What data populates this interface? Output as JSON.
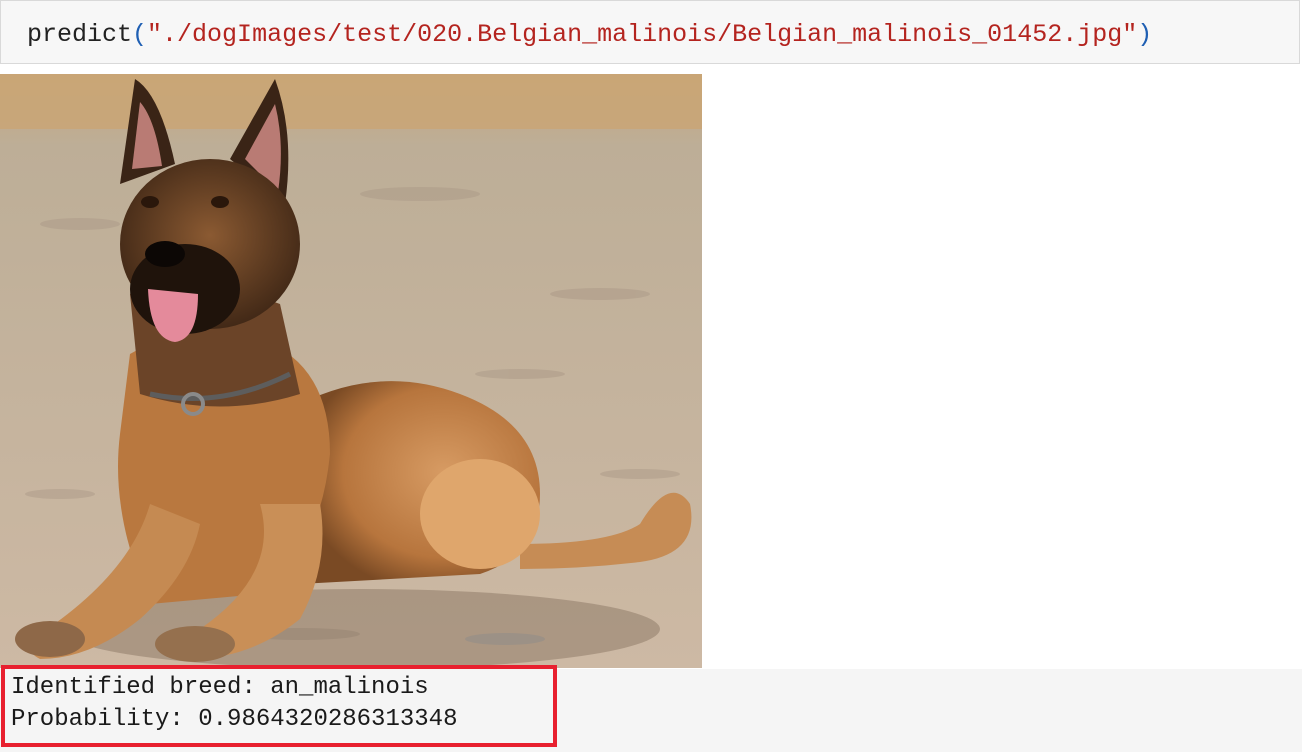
{
  "input_cell": {
    "function_name": "predict",
    "open_paren": "(",
    "argument": "\"./dogImages/test/020.Belgian_malinois/Belgian_malinois_01452.jpg\"",
    "close_paren": ")"
  },
  "output": {
    "line1": "Identified breed: an_malinois",
    "line2": "Probability: 0.9864320286313348"
  },
  "colors": {
    "string": "#b4241f",
    "paren": "#1f5fb3",
    "highlight": "#e8202f"
  }
}
